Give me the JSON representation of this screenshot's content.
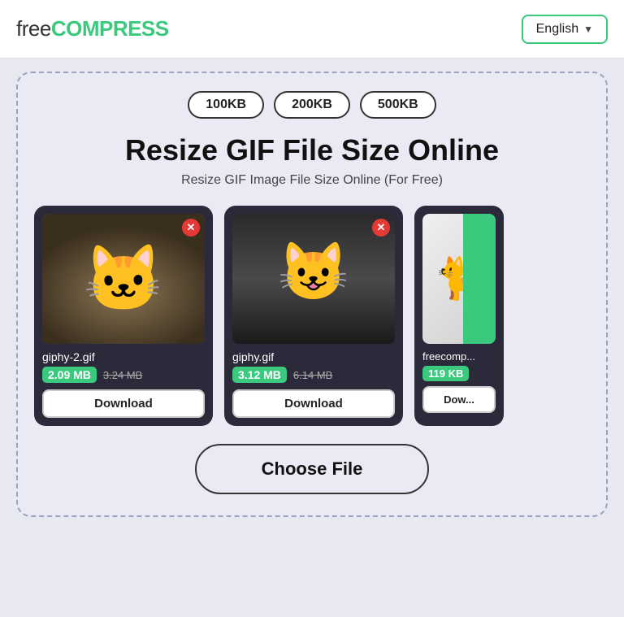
{
  "header": {
    "logo_free": "free",
    "logo_compress": "COMPRESS",
    "lang_label": "English",
    "lang_chevron": "▼"
  },
  "size_buttons": [
    {
      "label": "100KB"
    },
    {
      "label": "200KB"
    },
    {
      "label": "500KB"
    }
  ],
  "page": {
    "title": "Resize GIF File Size Online",
    "subtitle": "Resize GIF Image File Size Online (For Free)"
  },
  "cards": [
    {
      "filename": "giphy-2.gif",
      "size_new": "2.09 MB",
      "size_old": "3.24 MB",
      "download_label": "Download"
    },
    {
      "filename": "giphy.gif",
      "size_new": "3.12 MB",
      "size_old": "6.14 MB",
      "download_label": "Download"
    },
    {
      "filename": "freecomp...",
      "size_new": "119 KB",
      "download_label": "Dow..."
    }
  ],
  "choose_file": {
    "label": "Choose File"
  }
}
